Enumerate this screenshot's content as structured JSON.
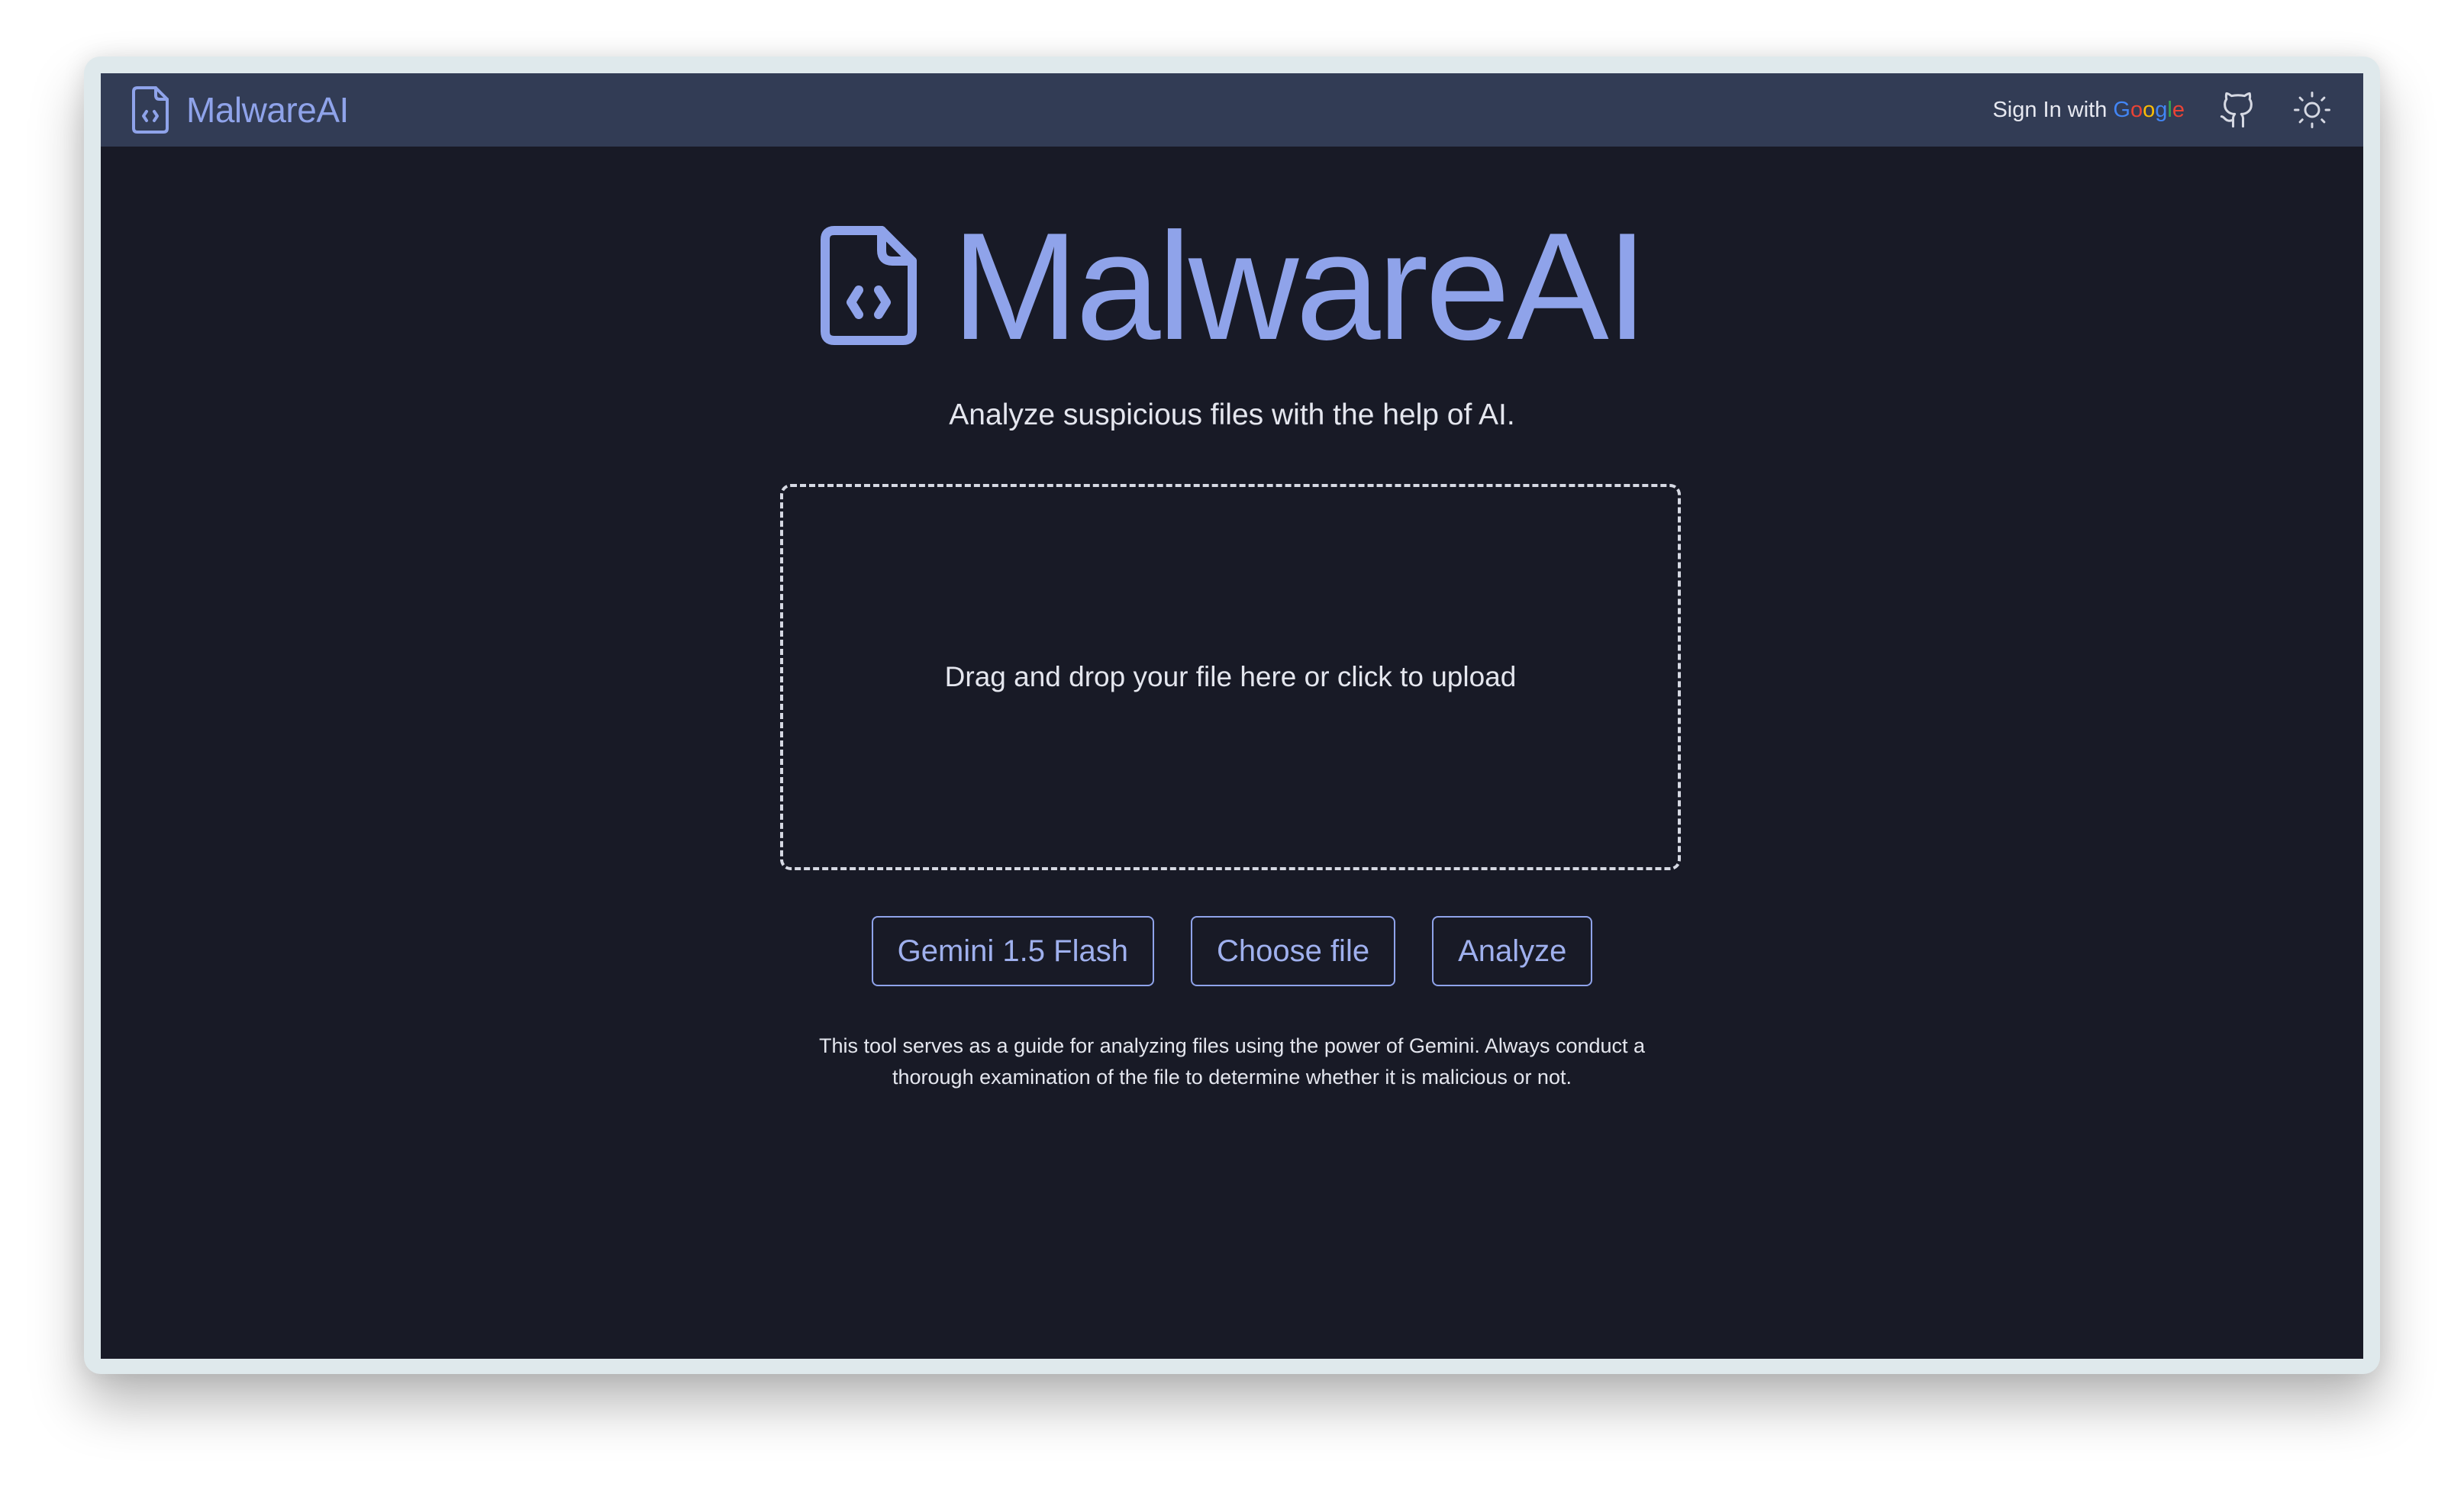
{
  "navbar": {
    "brand": "MalwareAI",
    "signin_prefix": "Sign In with",
    "google_letters": [
      "G",
      "o",
      "o",
      "g",
      "l",
      "e"
    ]
  },
  "hero": {
    "title": "MalwareAI",
    "subtitle": "Analyze suspicious files with the help of AI."
  },
  "upload": {
    "dropzone_text": "Drag and drop your file here or click to upload"
  },
  "actions": {
    "model_label": "Gemini 1.5 Flash",
    "choose_label": "Choose file",
    "analyze_label": "Analyze"
  },
  "disclaimer": {
    "line1": "This tool serves as a guide for analyzing files using the power of Gemini. Always conduct a",
    "line2": "thorough examination of the file to determine whether it is malicious or not."
  },
  "colors": {
    "accent": "#8fa3ea",
    "navbar_bg": "#323c55",
    "page_bg": "#181a26",
    "google_blue": "#4285F4",
    "google_red": "#EA4335",
    "google_yellow": "#FBBC05",
    "google_green": "#34A853"
  },
  "icons": {
    "brand": "file-code-icon",
    "github": "github-icon",
    "theme": "sun-icon"
  }
}
